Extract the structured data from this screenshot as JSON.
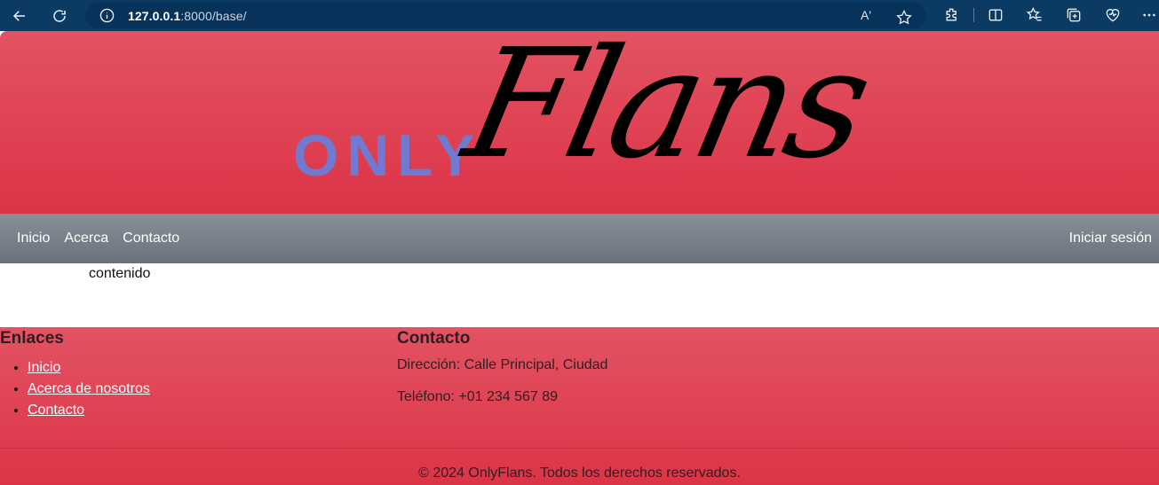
{
  "browser": {
    "url_host": "127.0.0.1",
    "url_rest": ":8000/base/",
    "read_aloud": "Aʹ"
  },
  "logo": {
    "only": "ONLY",
    "flans": "Flans"
  },
  "nav": {
    "items": [
      {
        "label": "Inicio"
      },
      {
        "label": "Acerca"
      },
      {
        "label": "Contacto"
      }
    ],
    "login": "Iniciar sesión"
  },
  "main": {
    "content": "contenido"
  },
  "footer": {
    "links_title": "Enlaces",
    "links": [
      {
        "label": "Inicio"
      },
      {
        "label": "Acerca de nosotros"
      },
      {
        "label": "Contacto"
      }
    ],
    "contact_title": "Contacto",
    "address": "Dirección: Calle Principal, Ciudad",
    "phone": "Teléfono: +01 234 567 89",
    "copyright": "© 2024 OnlyFlans. Todos los derechos reservados."
  },
  "colors": {
    "brand_red": "#db3447",
    "logo_purple": "#6f7ad0",
    "nav_gray": "#7a8089"
  }
}
